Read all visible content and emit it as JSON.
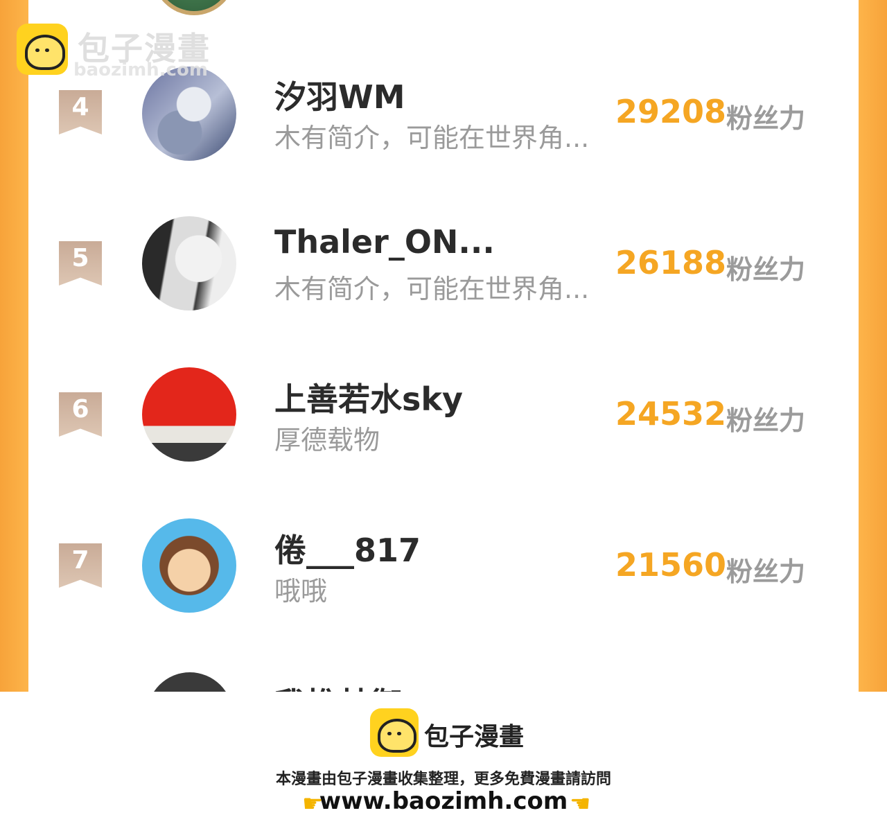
{
  "watermark": {
    "brand": "包子漫畫",
    "url": "baozimh.com"
  },
  "ranking": [
    {
      "rank": "4",
      "name": "汐羽WM",
      "intro": "木有简介，可能在世界角...",
      "score": "29208",
      "unit": "粉丝力"
    },
    {
      "rank": "5",
      "name": "Thaler_ON...",
      "intro": "木有简介，可能在世界角...",
      "score": "26188",
      "unit": "粉丝力"
    },
    {
      "rank": "6",
      "name": "上善若水sky",
      "intro": "厚德载物",
      "score": "24532",
      "unit": "粉丝力"
    },
    {
      "rank": "7",
      "name": "倦___817",
      "intro": "哦哦",
      "score": "21560",
      "unit": "粉丝力"
    },
    {
      "rank": "",
      "name": "我推林御",
      "intro": "",
      "score": "",
      "unit": ""
    }
  ],
  "footer": {
    "brand": "包子漫畫",
    "note": "本漫畫由包子漫畫收集整理，更多免費漫畫請訪問",
    "url": "www.baozimh.com"
  },
  "colors": {
    "accent": "#f5a623",
    "side_bar": "#fdb44a",
    "rank_badge": "#d4b8a4"
  },
  "icons": {
    "left_hand": "pointing-right-hand-icon",
    "right_hand": "pointing-left-hand-icon",
    "logo": "bun-logo-icon"
  }
}
